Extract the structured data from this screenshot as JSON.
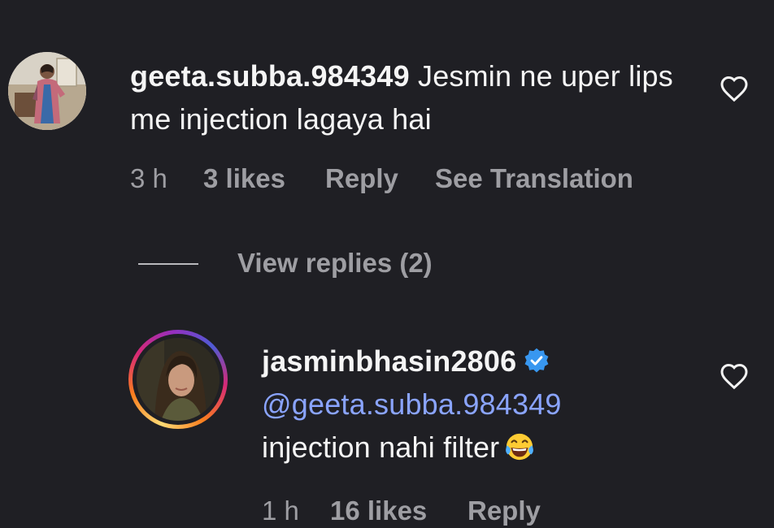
{
  "comment1": {
    "username": "geeta.subba.984349",
    "text": " Jesmin ne uper lips me injection lagaya hai",
    "time": "3 h",
    "likes": "3 likes",
    "reply_label": "Reply",
    "translate_label": "See Translation"
  },
  "view_replies": {
    "label": "View replies (2)"
  },
  "comment2": {
    "username": "jasminbhasin2806",
    "verified_icon": "verified-badge-icon",
    "mention": "@geeta.subba.984349",
    "text": "injection nahi filter",
    "emoji": "face-with-tears-of-joy",
    "time": "1 h",
    "likes": "16 likes",
    "reply_label": "Reply"
  },
  "colors": {
    "background": "#1f1f24",
    "meta_text": "#9e9ea3",
    "mention": "#8aa4ff",
    "verified": "#3897f0"
  }
}
